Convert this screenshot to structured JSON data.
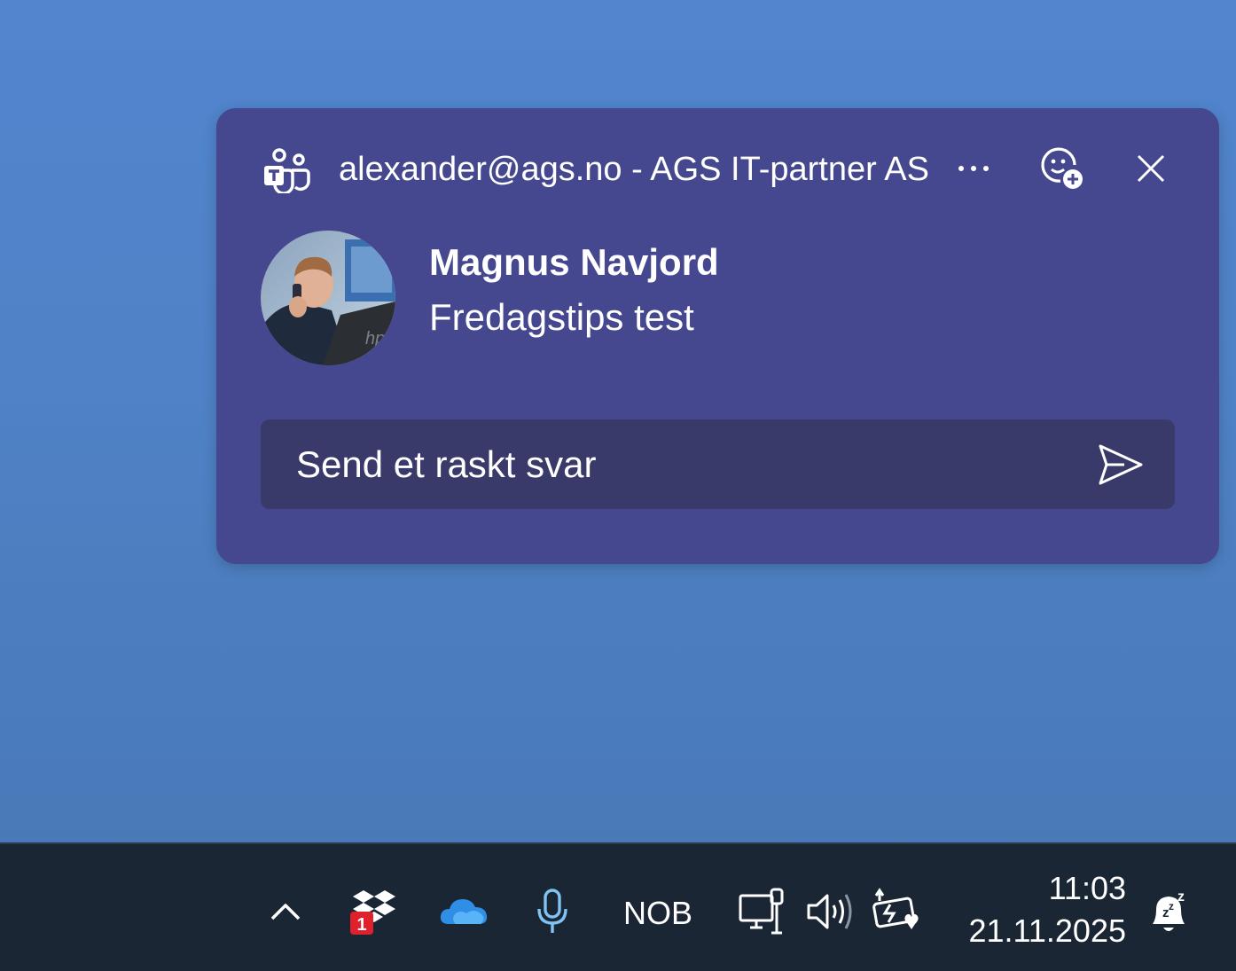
{
  "toast": {
    "app_icon": "teams-icon",
    "source": "alexander@ags.no - AGS IT-partner AS",
    "more_icon": "more-options-icon",
    "emoji_icon": "add-reaction-icon",
    "close_icon": "close-icon",
    "sender": "Magnus Navjord",
    "message": "Fredagstips test",
    "reply_placeholder": "Send et raskt svar",
    "send_icon": "send-icon",
    "colors": {
      "background": "#45478f",
      "reply_box": "#393a6a",
      "text": "#ffffff"
    }
  },
  "taskbar": {
    "chevron_icon": "chevron-up-icon",
    "dropbox_icon": "dropbox-icon",
    "dropbox_badge": "1",
    "onedrive_icon": "onedrive-icon",
    "mic_icon": "microphone-icon",
    "language": "NOB",
    "network_icon": "network-icon",
    "volume_icon": "volume-icon",
    "battery_icon": "battery-charging-icon",
    "time": "11:03",
    "date": "21.11.2025",
    "notification_icon": "notifications-snoozed-icon",
    "colors": {
      "background": "#1b2634",
      "badge": "#e0202a",
      "onedrive": "#2f8ee6",
      "mic": "#7fc4f5"
    }
  }
}
